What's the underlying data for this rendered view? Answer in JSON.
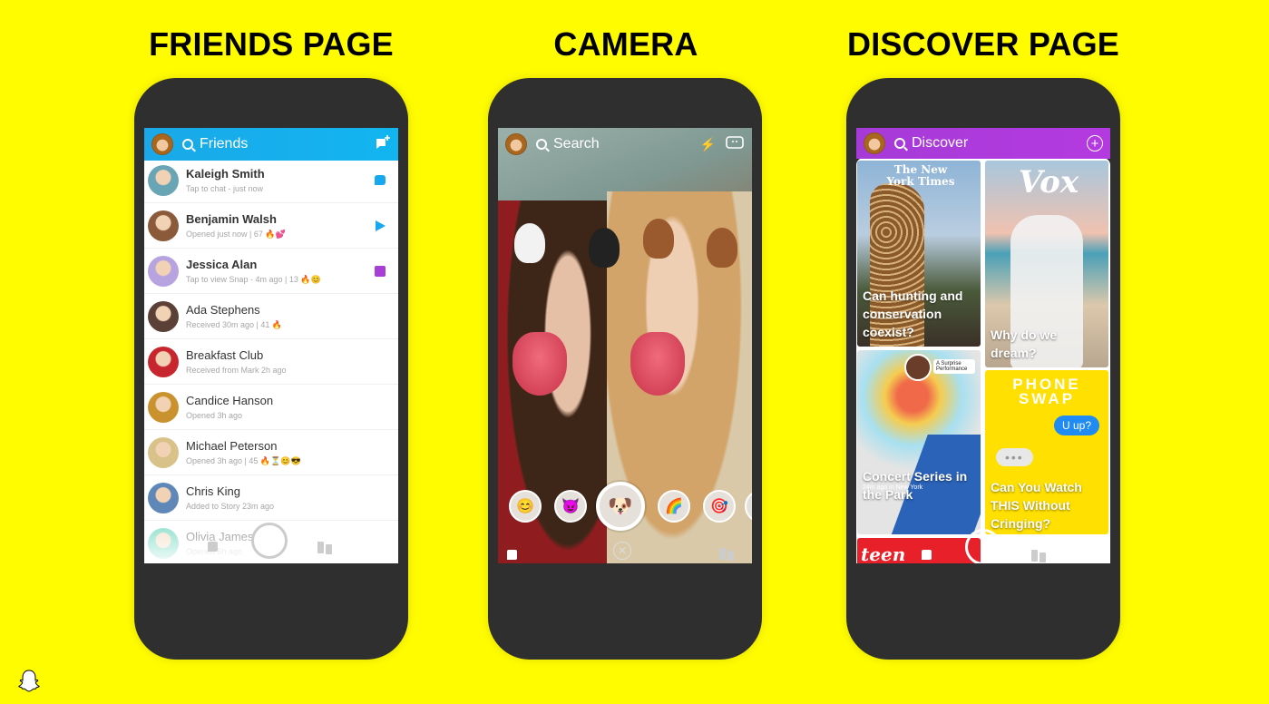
{
  "headings": {
    "friends": "FRIENDS PAGE",
    "camera": "CAMERA",
    "discover": "DISCOVER PAGE"
  },
  "colors": {
    "background": "#FFFC00",
    "phone_frame": "#2F2F2F",
    "friends_accent": "#12B5F0",
    "discover_accent": "#B43AE0",
    "chat_blue": "#18A8F0",
    "snap_purple": "#A83ED8"
  },
  "friends": {
    "title": "Friends",
    "new_chat_icon": "new-chat-icon",
    "rows": [
      {
        "name": "Kaleigh Smith",
        "sub": "Tap to chat - just now",
        "bold": true,
        "status": "chat",
        "avatar_color": "#6aa5b5"
      },
      {
        "name": "Benjamin Walsh",
        "sub": "Opened just now | 67 🔥💕",
        "bold": true,
        "status": "send",
        "avatar_color": "#8a5a3a"
      },
      {
        "name": "Jessica Alan",
        "sub": "Tap to view Snap - 4m ago | 13 🔥😊",
        "bold": true,
        "status": "snap",
        "avatar_color": "#b7a3e0"
      },
      {
        "name": "Ada Stephens",
        "sub": "Received 30m ago | 41 🔥",
        "bold": false,
        "status": "",
        "avatar_color": "#5a4036"
      },
      {
        "name": "Breakfast Club",
        "sub": "Received from Mark 2h ago",
        "bold": false,
        "status": "",
        "avatar_color": "#c8262e"
      },
      {
        "name": "Candice Hanson",
        "sub": "Opened 3h ago",
        "bold": false,
        "status": "",
        "avatar_color": "#c9922f"
      },
      {
        "name": "Michael Peterson",
        "sub": "Opened 3h ago | 45 🔥⏳😊😎",
        "bold": false,
        "status": "",
        "avatar_color": "#d9c18a"
      },
      {
        "name": "Chris King",
        "sub": "Added to Story 23m ago",
        "bold": false,
        "status": "",
        "avatar_color": "#5f88b8"
      },
      {
        "name": "Olivia James",
        "sub": "Opened 5h ago",
        "bold": false,
        "status": "",
        "avatar_color": "#3cc9a8"
      }
    ]
  },
  "camera": {
    "search_label": "Search",
    "flash_icon": "flash-off-icon",
    "flip_icon": "flip-camera-icon",
    "lenses": [
      "😊",
      "😈",
      "🐶",
      "🌈",
      "🎯",
      "🙂"
    ],
    "close_glyph": "✕"
  },
  "discover": {
    "title": "Discover",
    "add_glyph": "+",
    "tiles": [
      {
        "brand": "The New York Times",
        "caption": "Can hunting and conservation coexist?"
      },
      {
        "brand": "Vox",
        "caption": "Why do we dream?"
      },
      {
        "brand": "A Surprise Performance",
        "location": "24m ago in New York",
        "caption": "Concert Series in the Park"
      },
      {
        "brand": "PHONE SWAP",
        "bubble_sent": "U up?",
        "bubble_typing": "•••",
        "caption": "Can You Watch THIS Without Cringing?"
      },
      {
        "brand": "teen VOGUE",
        "caption": ""
      }
    ]
  }
}
